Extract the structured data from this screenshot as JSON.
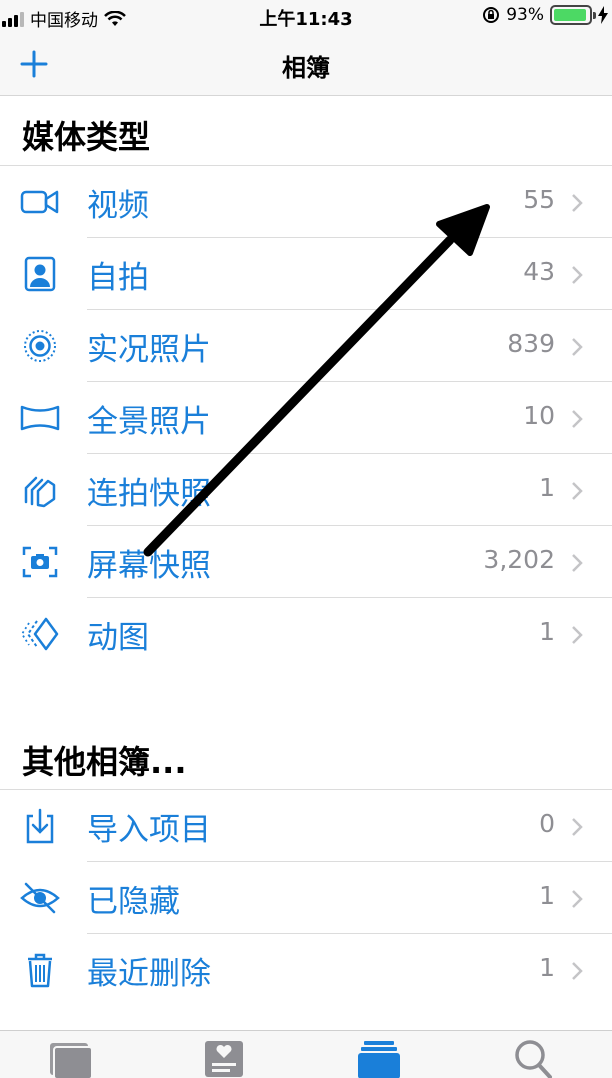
{
  "status": {
    "carrier": "中国移动",
    "time": "上午11:43",
    "battery_percent": "93%",
    "battery_level": 0.93,
    "battery_color": "#4cd964"
  },
  "nav": {
    "title": "相簿",
    "add_icon": "plus-icon"
  },
  "media_types": {
    "title": "媒体类型",
    "items": [
      {
        "icon": "video-icon",
        "label": "视频",
        "count": "55"
      },
      {
        "icon": "selfie-icon",
        "label": "自拍",
        "count": "43"
      },
      {
        "icon": "live-photo-icon",
        "label": "实况照片",
        "count": "839"
      },
      {
        "icon": "panorama-icon",
        "label": "全景照片",
        "count": "10"
      },
      {
        "icon": "burst-icon",
        "label": "连拍快照",
        "count": "1"
      },
      {
        "icon": "screenshot-icon",
        "label": "屏幕快照",
        "count": "3,202"
      },
      {
        "icon": "animated-icon",
        "label": "动图",
        "count": "1"
      }
    ]
  },
  "other_albums": {
    "title": "其他相簿...",
    "items": [
      {
        "icon": "import-icon",
        "label": "导入项目",
        "count": "0"
      },
      {
        "icon": "hidden-icon",
        "label": "已隐藏",
        "count": "1"
      },
      {
        "icon": "trash-icon",
        "label": "最近删除",
        "count": "1"
      }
    ]
  },
  "tabs": [
    {
      "icon": "photos-tab-icon",
      "active": false
    },
    {
      "icon": "for-you-tab-icon",
      "active": false
    },
    {
      "icon": "albums-tab-icon",
      "active": true
    },
    {
      "icon": "search-tab-icon",
      "active": false
    }
  ],
  "colors": {
    "accent": "#1a7fd9",
    "inactive_tab": "#8e8e93",
    "annotation_arrow": "#000000"
  }
}
